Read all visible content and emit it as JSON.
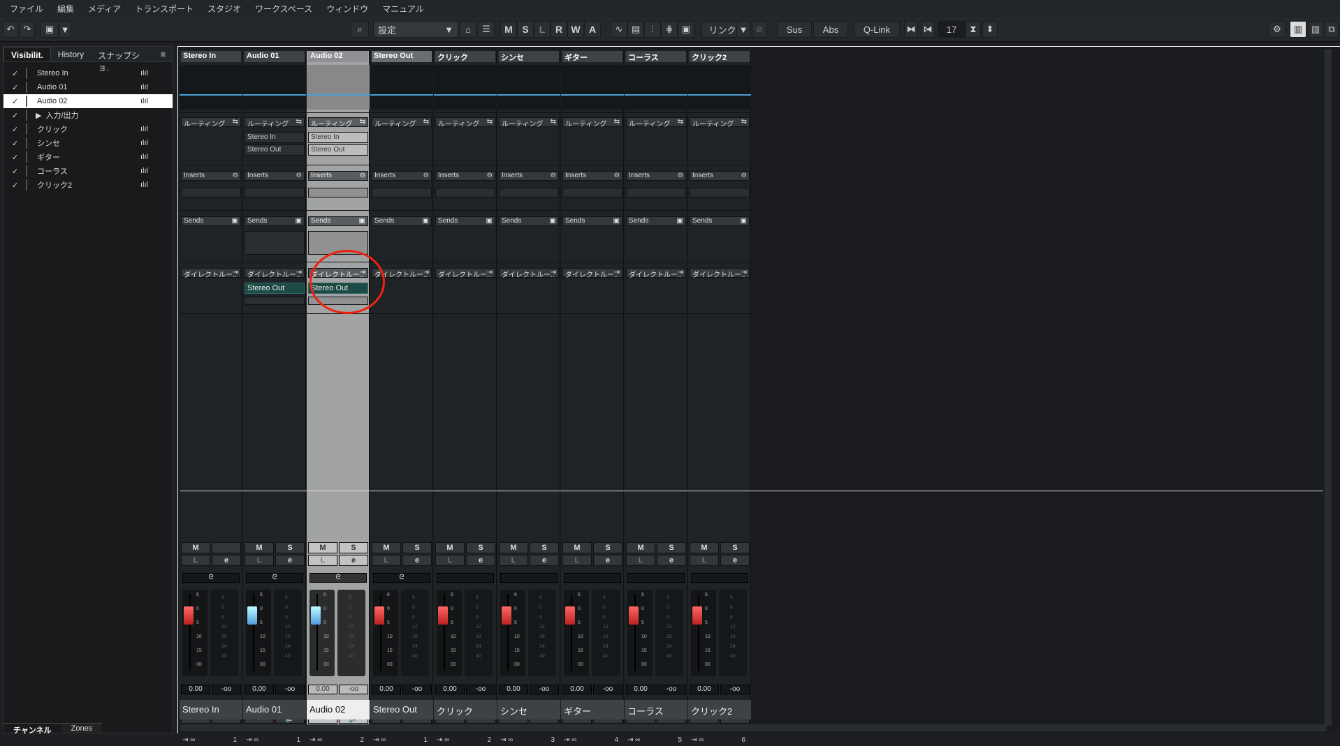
{
  "menubar": {
    "items": [
      "ファイル",
      "編集",
      "メディア",
      "トランスポート",
      "スタジオ",
      "ワークスペース",
      "ウィンドウ",
      "マニュアル"
    ]
  },
  "toolbar": {
    "config_value": "設定",
    "m": "M",
    "s": "S",
    "l": "L",
    "r": "R",
    "w": "W",
    "a": "A",
    "link_label": "リンク",
    "sus_label": "Sus",
    "abs_label": "Abs",
    "qlink_label": "Q-Link",
    "channel_count": "17"
  },
  "left_panel": {
    "tabs": [
      "Visibilit.",
      "History",
      "スナップショ."
    ],
    "items": [
      {
        "name": "Stereo In",
        "check": "✓",
        "wave": "ılıl",
        "indent": false
      },
      {
        "name": "Audio 01",
        "check": "✓",
        "wave": "ılıl",
        "indent": false
      },
      {
        "name": "Audio 02",
        "check": "✓",
        "wave": "ılıl",
        "indent": false
      },
      {
        "name": "入力/出力",
        "check": "✓",
        "wave": "",
        "indent": true
      },
      {
        "name": "クリック",
        "check": "✓",
        "wave": "ılıl",
        "indent": false
      },
      {
        "name": "シンセ",
        "check": "✓",
        "wave": "ılıl",
        "indent": false
      },
      {
        "name": "ギター",
        "check": "✓",
        "wave": "ılıl",
        "indent": false
      },
      {
        "name": "コーラス",
        "check": "✓",
        "wave": "ılıl",
        "indent": false
      },
      {
        "name": "クリック2",
        "check": "✓",
        "wave": "ılıl",
        "indent": false
      }
    ],
    "bottom_tabs": [
      "チャンネル",
      "Zones"
    ]
  },
  "mixer": {
    "section_labels": {
      "routing": "ルーティング",
      "inserts": "Inserts",
      "sends": "Sends",
      "direct": "ダイレクトルー.."
    },
    "channels": [
      {
        "name": "Stereo In",
        "num": "1",
        "routing": [
          "",
          ""
        ],
        "direct": "",
        "has_solo": false,
        "rec": false,
        "fader": "0.00",
        "meter": "-oo"
      },
      {
        "name": "Audio 01",
        "num": "1",
        "routing": [
          "Stereo In",
          "Stereo Out"
        ],
        "direct": "Stereo Out",
        "has_solo": true,
        "rec": false,
        "fader": "0.00",
        "meter": "-oo"
      },
      {
        "name": "Audio 02",
        "num": "2",
        "routing": [
          "Stereo In",
          "Stereo Out"
        ],
        "direct": "Stereo Out",
        "has_solo": true,
        "rec": true,
        "fader": "0.00",
        "meter": "-oo"
      },
      {
        "name": "Stereo Out",
        "num": "1",
        "routing": [
          "",
          ""
        ],
        "direct": "",
        "has_solo": true,
        "rec": false,
        "fader": "0.00",
        "meter": "-oo"
      },
      {
        "name": "クリック",
        "num": "2",
        "routing": [
          "",
          ""
        ],
        "direct": "",
        "has_solo": true,
        "rec": false,
        "fader": "0.00",
        "meter": "-oo"
      },
      {
        "name": "シンセ",
        "num": "3",
        "routing": [
          "",
          ""
        ],
        "direct": "",
        "has_solo": true,
        "rec": false,
        "fader": "0.00",
        "meter": "-oo"
      },
      {
        "name": "ギター",
        "num": "4",
        "routing": [
          "",
          ""
        ],
        "direct": "",
        "has_solo": true,
        "rec": false,
        "fader": "0.00",
        "meter": "-oo"
      },
      {
        "name": "コーラス",
        "num": "5",
        "routing": [
          "",
          ""
        ],
        "direct": "",
        "has_solo": true,
        "rec": false,
        "fader": "0.00",
        "meter": "-oo"
      },
      {
        "name": "クリック2",
        "num": "6",
        "routing": [
          "",
          ""
        ],
        "direct": "",
        "has_solo": true,
        "rec": false,
        "fader": "0.00",
        "meter": "-oo"
      }
    ],
    "button_labels": {
      "mute": "M",
      "solo": "S",
      "listen": "L",
      "edit": "e",
      "read": "R",
      "write": "W"
    },
    "scale": [
      "6",
      "0",
      "5",
      "10",
      "15",
      "00"
    ],
    "meter_scale": [
      "6",
      "0",
      "6",
      "12",
      "18",
      "24",
      "40"
    ]
  }
}
